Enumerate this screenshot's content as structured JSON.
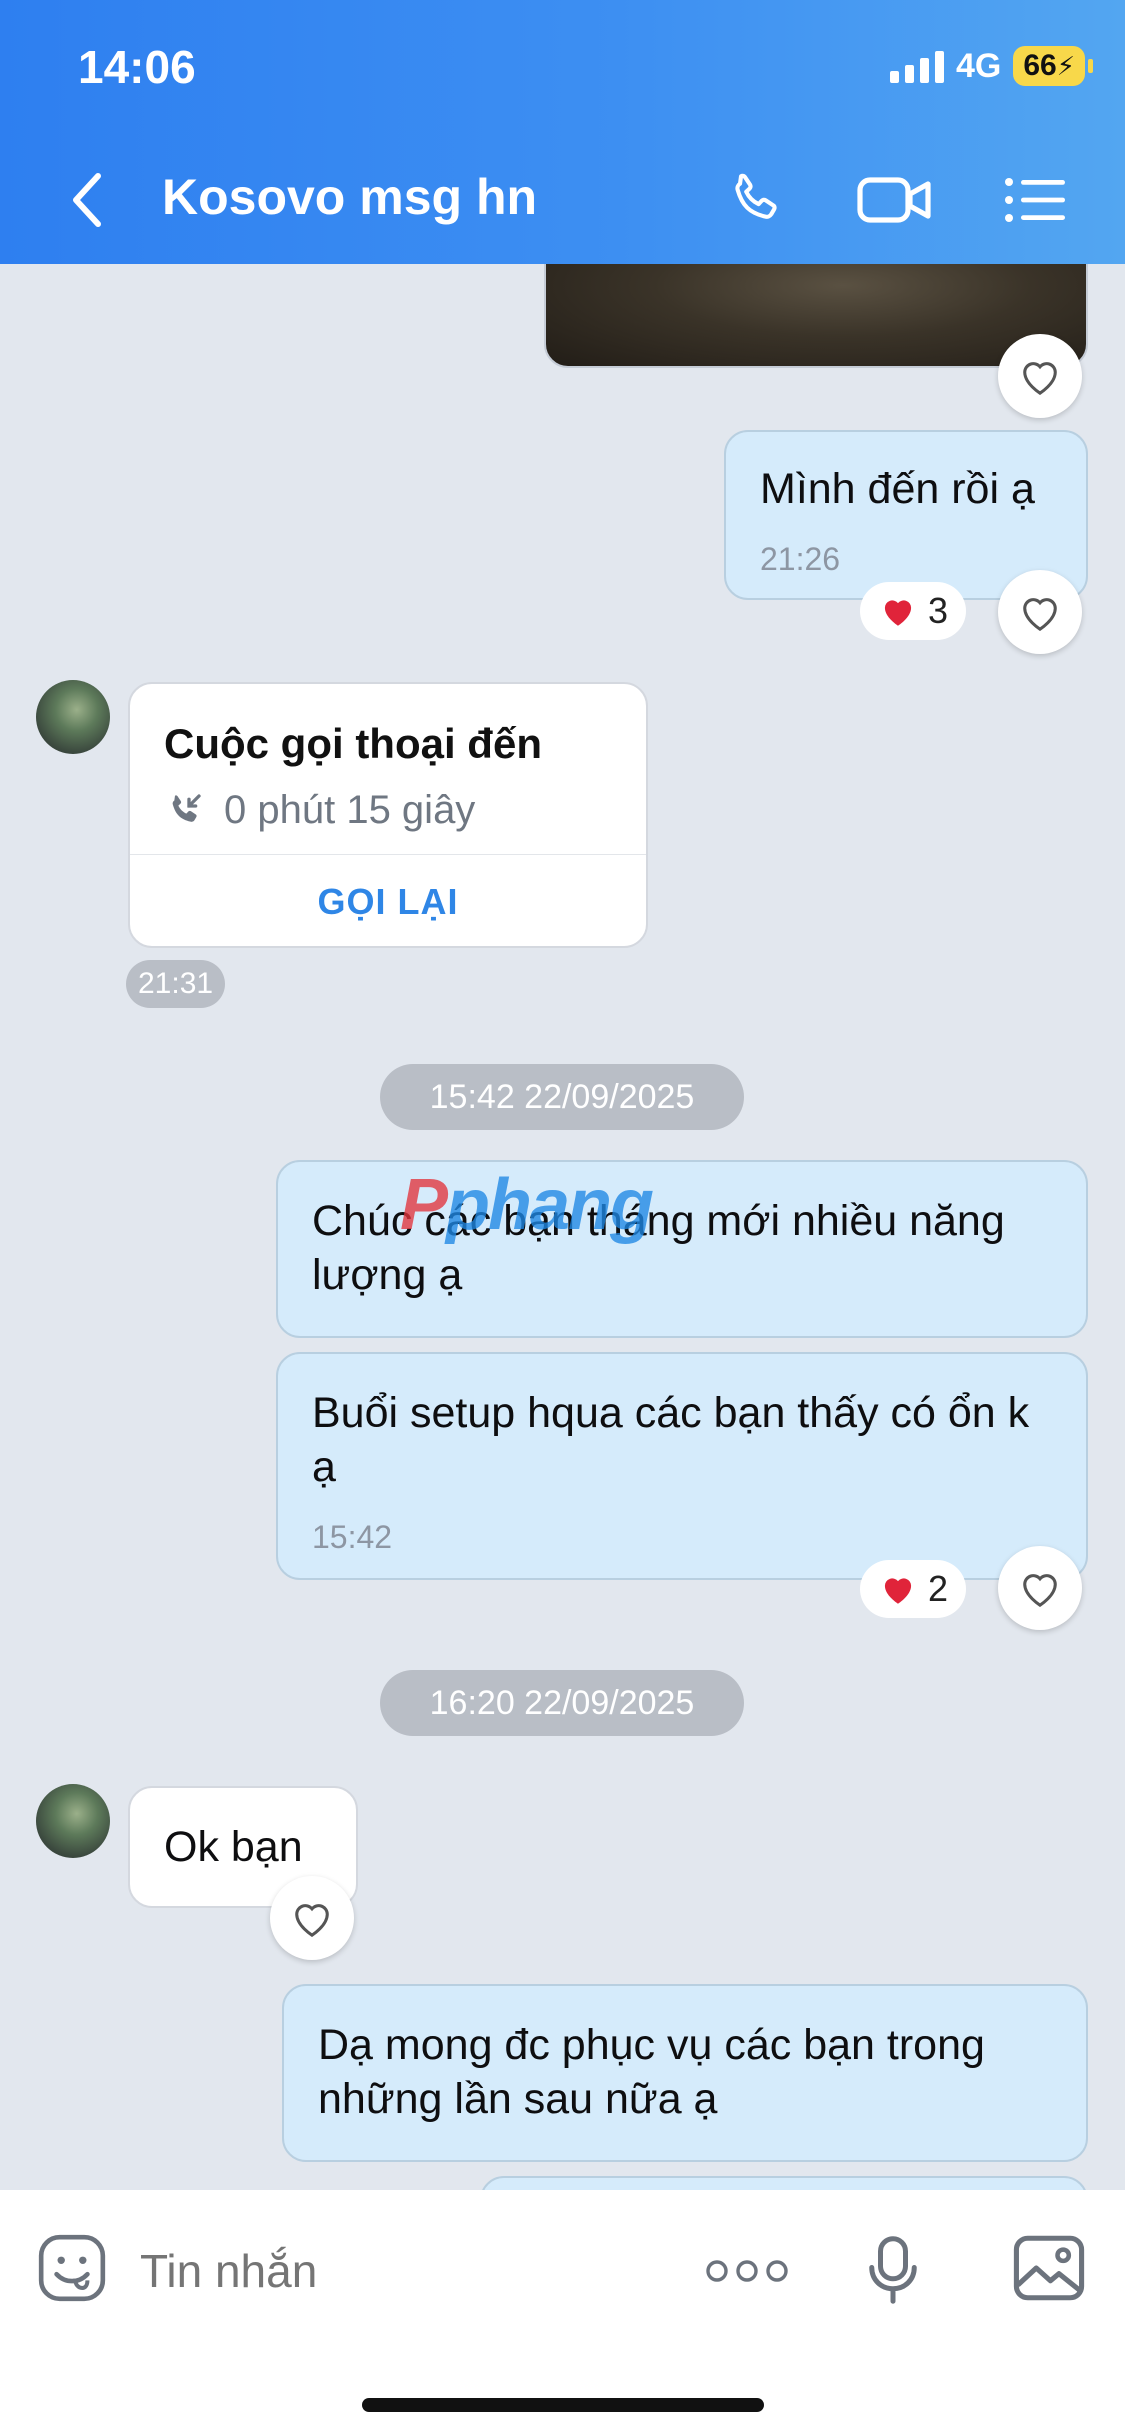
{
  "status_bar": {
    "time": "14:06",
    "network": "4G",
    "battery": "66"
  },
  "header": {
    "title": "Kosovo msg hn"
  },
  "messages": {
    "m1": {
      "text": "Mình đến rồi ạ",
      "time": "21:26",
      "reaction_count": "3"
    },
    "call": {
      "title": "Cuộc gọi thoại đến",
      "duration": "0 phút 15 giây",
      "action": "GỌI LẠI",
      "time": "21:31"
    },
    "date1": "15:42 22/09/2025",
    "m2": {
      "text": "Chúc các bạn tháng mới nhiều năng lượng ạ"
    },
    "m3": {
      "text": "Buổi setup hqua các bạn thấy có ổn k ạ",
      "time": "15:42",
      "reaction_count": "2"
    },
    "date2": "16:20 22/09/2025",
    "m4": {
      "text": "Ok bạn"
    },
    "m5": {
      "text": "Dạ mong đc phục vụ các bạn trong những lần sau nữa ạ"
    }
  },
  "watermark": "Pphang",
  "composer": {
    "placeholder": "Tin nhắn"
  },
  "colors": {
    "header_start": "#2e7ff0",
    "header_end": "#53a6f1",
    "outgoing_bubble": "#d5ebfb",
    "accent": "#2f86e6",
    "reaction_heart": "#e0243a"
  }
}
